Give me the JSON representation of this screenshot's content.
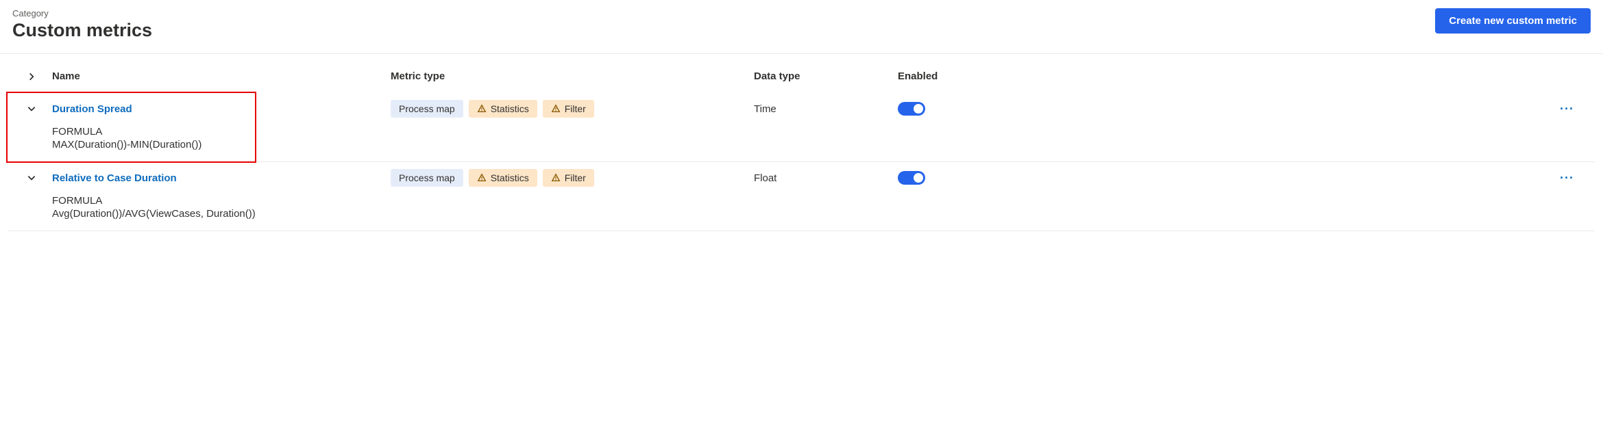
{
  "header": {
    "category_label": "Category",
    "page_title": "Custom metrics",
    "create_button": "Create new custom metric"
  },
  "columns": {
    "name": "Name",
    "metric_type": "Metric type",
    "data_type": "Data type",
    "enabled": "Enabled"
  },
  "badges": {
    "process_map": "Process map",
    "statistics": "Statistics",
    "filter": "Filter"
  },
  "labels": {
    "formula": "FORMULA"
  },
  "rows": [
    {
      "name": "Duration Spread",
      "data_type": "Time",
      "formula": "MAX(Duration())-MIN(Duration())",
      "highlighted": true
    },
    {
      "name": "Relative to Case Duration",
      "data_type": "Float",
      "formula": "Avg(Duration())/AVG(ViewCases, Duration())",
      "highlighted": false
    }
  ]
}
